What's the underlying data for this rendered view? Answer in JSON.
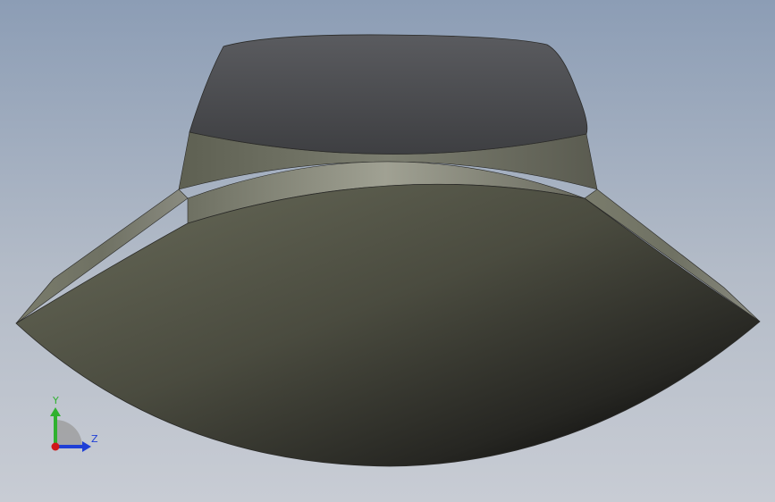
{
  "viewport": {
    "background_top": "#8c9db5",
    "background_bottom": "#c8ccd4"
  },
  "triad": {
    "y_label": "Y",
    "z_label": "Z",
    "y_color": "#2fb12f",
    "z_color": "#1f3fd6",
    "x_color": "#d01818"
  }
}
